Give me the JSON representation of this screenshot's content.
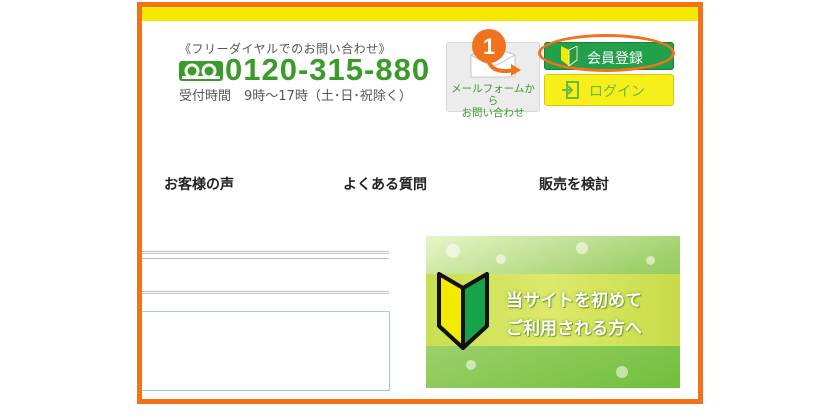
{
  "header": {
    "free_dial_label": "《フリーダイヤルでのお問い合わせ》",
    "phone": "0120-315-880",
    "hours": "受付時間　9時～17時（土･日･祝除く）",
    "mail_form_line1": "メールフォームから",
    "mail_form_line2": "お問い合わせ",
    "register_label": "会員登録",
    "login_label": "ログイン",
    "step_badge": "1"
  },
  "nav": {
    "items": [
      "お客様の声",
      "よくある質問",
      "販売を検討"
    ]
  },
  "banner": {
    "line1": "当サイトを初めて",
    "line2": "ご利用される方へ"
  },
  "colors": {
    "highlight_border": "#f2711c",
    "top_bar": "#f4e900",
    "register_green": "#22a04a",
    "login_yellow": "#f6ef1a",
    "phone_green": "#3a9a2a"
  }
}
